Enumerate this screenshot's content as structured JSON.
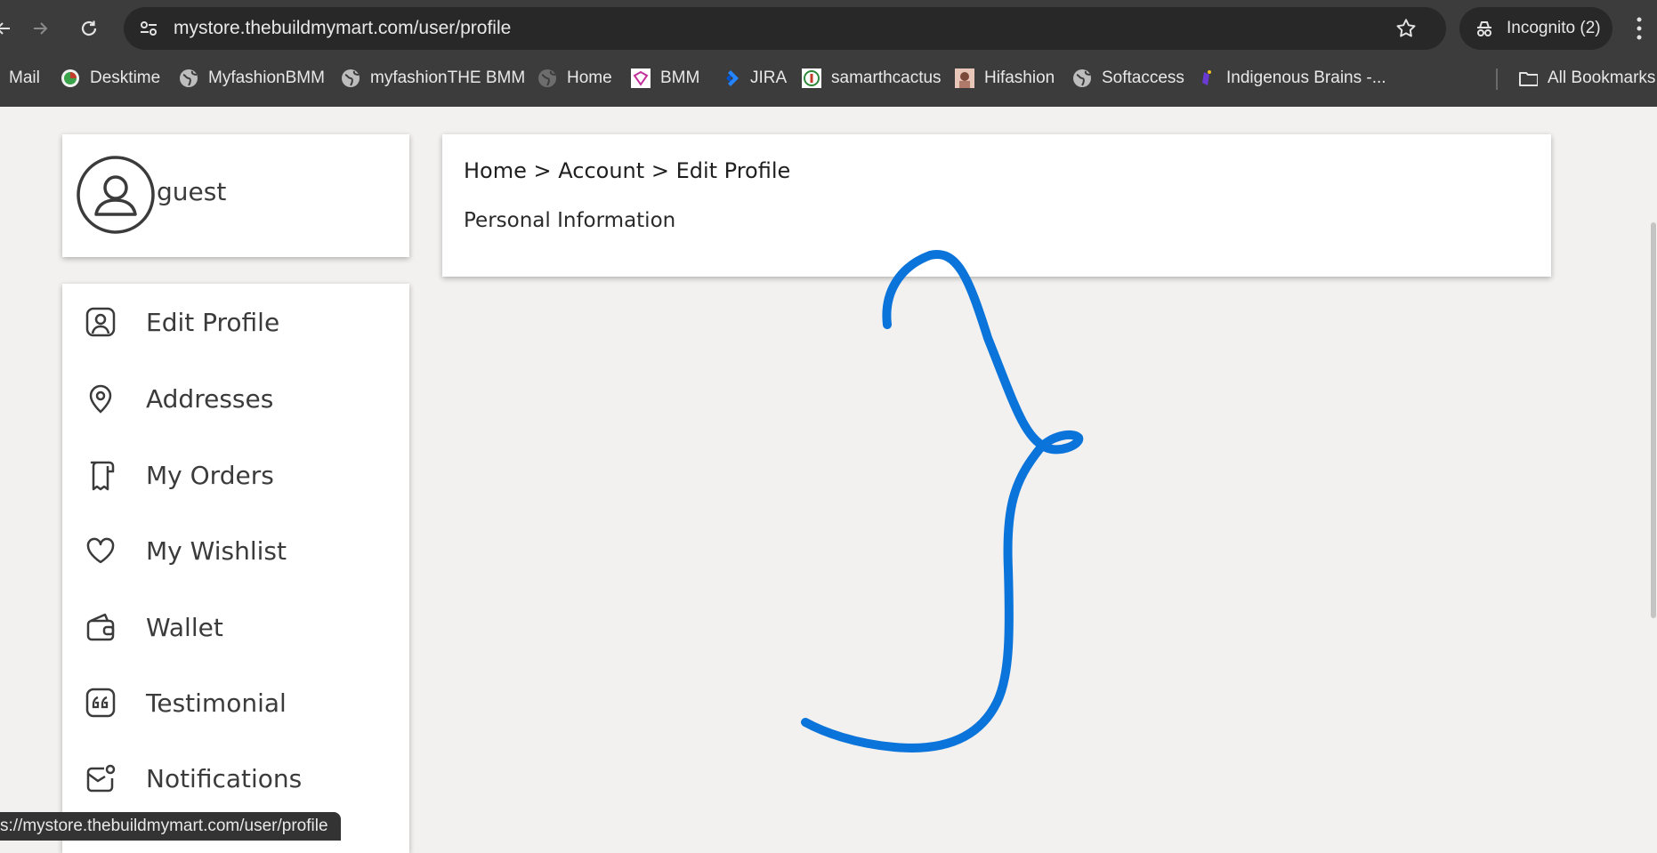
{
  "browser": {
    "url": "mystore.thebuildmymart.com/user/profile",
    "incognito_label": "Incognito (2)",
    "bookmarks": [
      "Mail",
      "Desktime",
      "MyfashionBMM",
      "myfashionTHE BMM",
      "Home",
      "BMM",
      "JIRA",
      "samarthcactus",
      "Hifashion",
      "Softaccess",
      "Indigenous Brains -..."
    ],
    "all_bookmarks_label": "All Bookmarks",
    "status_url": "s://mystore.thebuildmymart.com/user/profile"
  },
  "profile": {
    "username": "guest"
  },
  "sidebar": {
    "items": [
      {
        "label": "Edit Profile",
        "icon": "user-square-icon"
      },
      {
        "label": "Addresses",
        "icon": "location-pin-icon"
      },
      {
        "label": "My Orders",
        "icon": "receipt-icon"
      },
      {
        "label": "My Wishlist",
        "icon": "heart-icon"
      },
      {
        "label": "Wallet",
        "icon": "wallet-icon"
      },
      {
        "label": "Testimonial",
        "icon": "quote-icon"
      },
      {
        "label": "Notifications",
        "icon": "notification-mail-icon"
      }
    ]
  },
  "main": {
    "breadcrumb": {
      "home": "Home",
      "sep": ">",
      "account": "Account",
      "current": "Edit Profile"
    },
    "section_title": "Personal Information"
  },
  "annotation": {
    "color": "#0a74da"
  }
}
